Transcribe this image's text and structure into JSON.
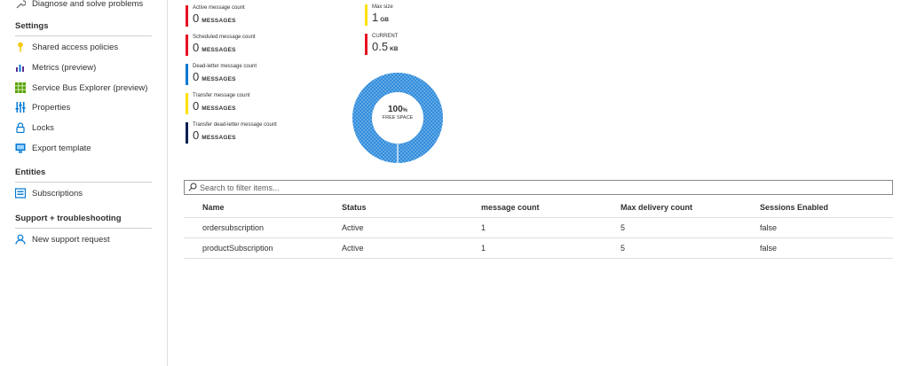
{
  "sidebar": {
    "top_item": {
      "label": "Diagnose and solve problems",
      "icon": "wrench-icon"
    },
    "sections": [
      {
        "title": "Settings",
        "items": [
          {
            "label": "Shared access policies",
            "icon": "key-icon",
            "color": "#f2c811"
          },
          {
            "label": "Metrics (preview)",
            "icon": "metrics-chart-icon",
            "color": "#5c2d91"
          },
          {
            "label": "Service Bus Explorer (preview)",
            "icon": "grid-icon",
            "color": "#57a300"
          },
          {
            "label": "Properties",
            "icon": "properties-icon",
            "color": "#0078d4"
          },
          {
            "label": "Locks",
            "icon": "lock-icon",
            "color": "#0078d4"
          },
          {
            "label": "Export template",
            "icon": "export-template-icon",
            "color": "#0078d4"
          }
        ]
      },
      {
        "title": "Entities",
        "items": [
          {
            "label": "Subscriptions",
            "icon": "subscriptions-icon",
            "color": "#0078d4"
          }
        ]
      },
      {
        "title": "Support + troubleshooting",
        "items": [
          {
            "label": "New support request",
            "icon": "support-person-icon",
            "color": "#0078d4"
          }
        ]
      }
    ]
  },
  "metrics": [
    {
      "label": "Active message count",
      "value": "0",
      "unit": "MESSAGES",
      "color": "#e81123"
    },
    {
      "label": "Scheduled message count",
      "value": "0",
      "unit": "MESSAGES",
      "color": "#e81123"
    },
    {
      "label": "Dead-letter message count",
      "value": "0",
      "unit": "MESSAGES",
      "color": "#0078d4"
    },
    {
      "label": "Transfer message count",
      "value": "0",
      "unit": "MESSAGES",
      "color": "#fce100"
    },
    {
      "label": "Transfer dead-letter message count",
      "value": "0",
      "unit": "MESSAGES",
      "color": "#002050"
    }
  ],
  "size": {
    "max": {
      "label": "Max size",
      "value": "1",
      "unit": "GB",
      "color": "#fce100"
    },
    "current": {
      "label": "CURRENT",
      "value": "0.5",
      "unit": "KB",
      "color": "#e81123"
    }
  },
  "donut": {
    "percent": "100",
    "percent_sign": "%",
    "caption": "FREE SPACE",
    "free_fraction": 1.0,
    "color": "#2b88d8"
  },
  "search": {
    "placeholder": "Search to filter items..."
  },
  "table": {
    "headers": [
      "Name",
      "Status",
      "message count",
      "Max delivery count",
      "Sessions Enabled"
    ],
    "rows": [
      [
        "ordersubscription",
        "Active",
        "1",
        "5",
        "false"
      ],
      [
        "productSubscription",
        "Active",
        "1",
        "5",
        "false"
      ]
    ]
  }
}
